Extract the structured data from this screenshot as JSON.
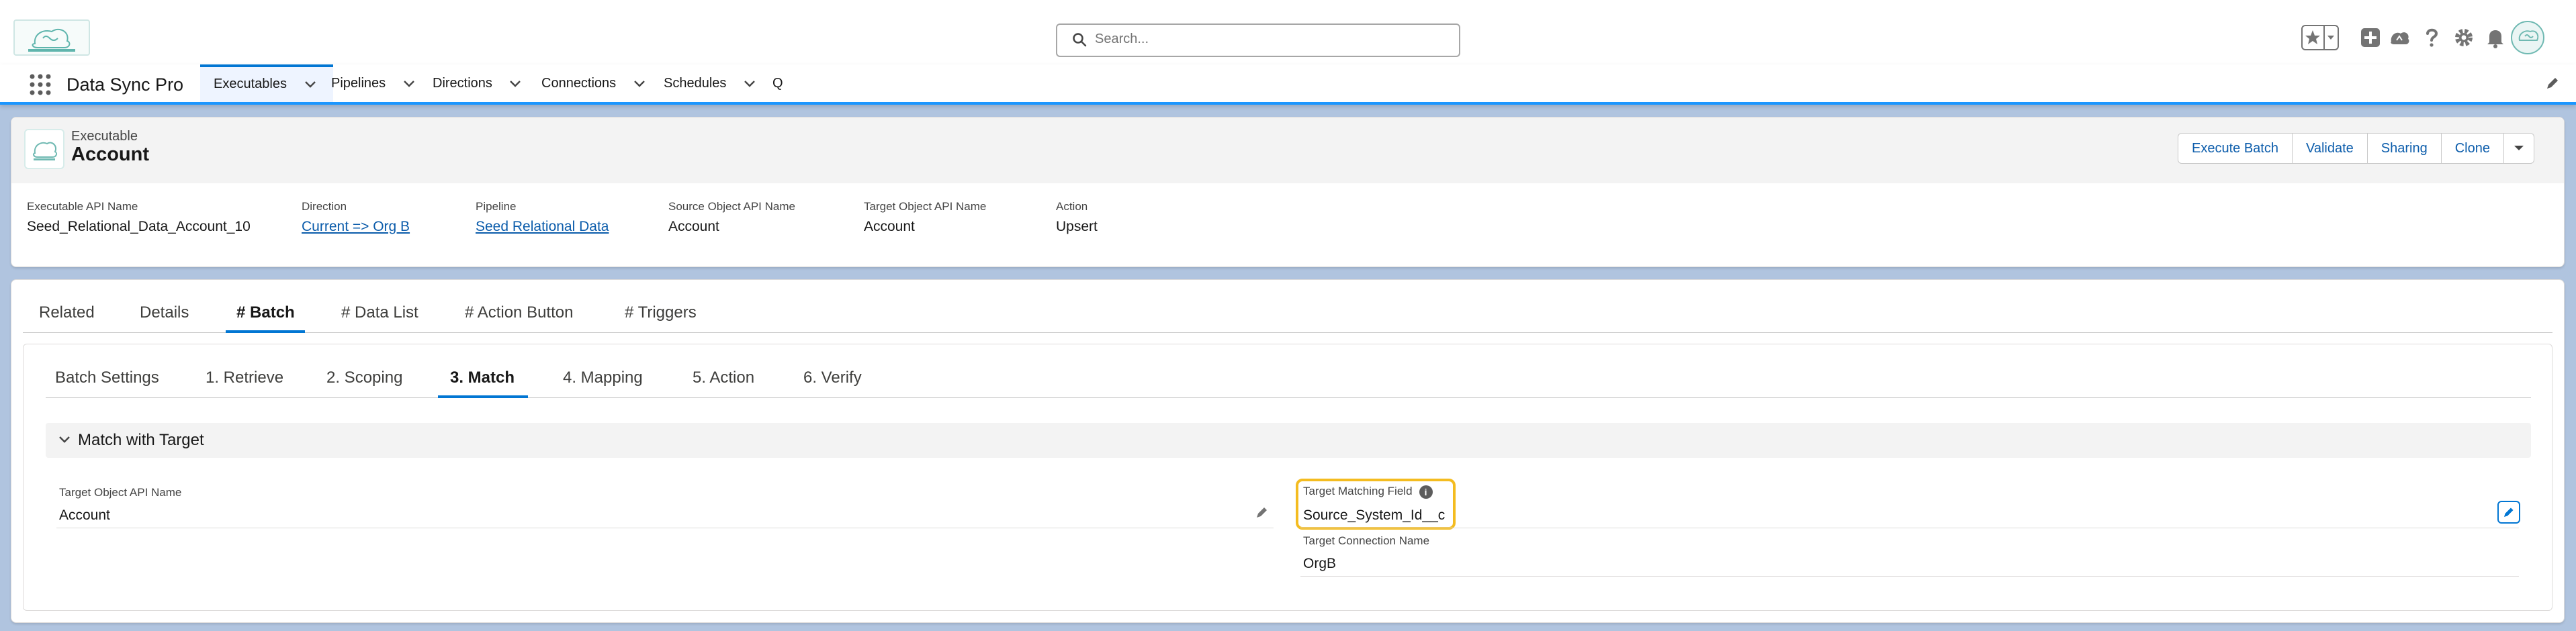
{
  "header": {
    "search_placeholder": "Search...",
    "app_name": "Data Sync Pro",
    "icons": [
      "logo-icon",
      "favorites-star-icon",
      "favorites-dropdown-icon",
      "global-actions-add-icon",
      "trailhead-icon",
      "help-icon",
      "setup-gear-icon",
      "notifications-bell-icon",
      "user-avatar-icon",
      "edit-nav-pencil-icon"
    ]
  },
  "nav": {
    "tabs": [
      {
        "label": "Executables",
        "active": true
      },
      {
        "label": "Pipelines"
      },
      {
        "label": "Directions"
      },
      {
        "label": "Connections"
      },
      {
        "label": "Schedules"
      },
      {
        "label": "Q"
      }
    ]
  },
  "record": {
    "object_type": "Executable",
    "name": "Account",
    "actions": [
      "Execute Batch",
      "Validate",
      "Sharing",
      "Clone"
    ],
    "highlights": [
      {
        "label": "Executable API Name",
        "value": "Seed_Relational_Data_Account_10",
        "link": false
      },
      {
        "label": "Direction",
        "value": "Current => Org B",
        "link": true
      },
      {
        "label": "Pipeline",
        "value": "Seed Relational Data",
        "link": true
      },
      {
        "label": "Source Object API Name",
        "value": "Account",
        "link": false
      },
      {
        "label": "Target Object API Name",
        "value": "Account",
        "link": false
      },
      {
        "label": "Action",
        "value": "Upsert",
        "link": false
      }
    ]
  },
  "tabs": [
    "Related",
    "Details",
    "# Batch",
    "# Data List",
    "# Action Button",
    "# Triggers"
  ],
  "active_tab": "# Batch",
  "subtabs": [
    "Batch Settings",
    "1. Retrieve",
    "2. Scoping",
    "3. Match",
    "4. Mapping",
    "5. Action",
    "6. Verify"
  ],
  "active_subtab": "3. Match",
  "section": {
    "title": "Match with Target",
    "fields": {
      "target_object_label": "Target Object API Name",
      "target_object_value": "Account",
      "matching_field_label": "Target Matching Field",
      "matching_field_value": "Source_System_Id__c",
      "connection_label": "Target Connection Name",
      "connection_value": "OrgB"
    }
  },
  "colors": {
    "brand": "#0176d3",
    "highlight": "#f4bc20",
    "background": "#b0c4df"
  }
}
